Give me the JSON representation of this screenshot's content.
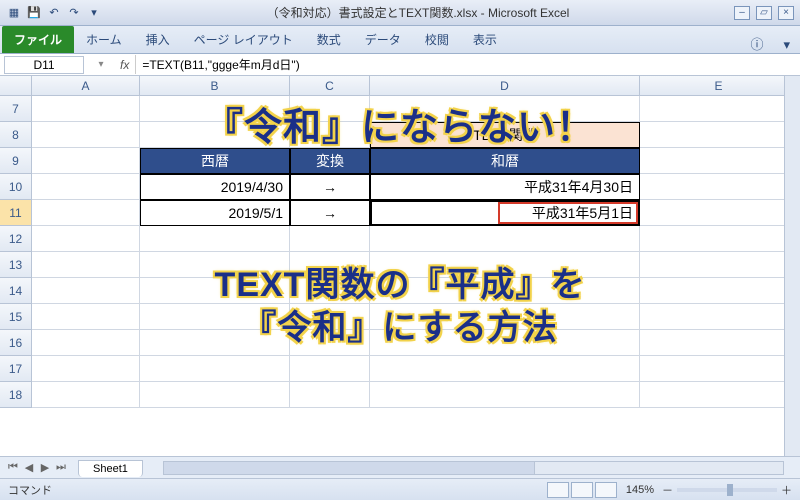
{
  "window": {
    "title": "（令和対応）書式設定とTEXT関数.xlsx - Microsoft Excel"
  },
  "ribbon": {
    "file": "ファイル",
    "tabs": [
      "ホーム",
      "挿入",
      "ページ レイアウト",
      "数式",
      "データ",
      "校閲",
      "表示"
    ]
  },
  "formula_bar": {
    "namebox": "D11",
    "fx": "fx",
    "formula": "=TEXT(B11,\"ggge年m月d日\")"
  },
  "columns": [
    "A",
    "B",
    "C",
    "D",
    "E"
  ],
  "visible_rows": [
    7,
    8,
    9,
    10,
    11,
    12,
    13,
    14,
    15,
    16,
    17,
    18
  ],
  "table": {
    "title": "TEXT関数",
    "headers": {
      "b": "西暦",
      "c": "変換",
      "d": "和暦"
    },
    "rows": [
      {
        "b": "2019/4/30",
        "c": "→",
        "d": "平成31年4月30日"
      },
      {
        "b": "2019/5/1",
        "c": "→",
        "d": "平成31年5月1日"
      }
    ]
  },
  "overlay": {
    "line1": "『令和』にならない！",
    "line2a": "TEXT関数の『平成』を",
    "line2b": "『令和』にする方法"
  },
  "sheet": {
    "name": "Sheet1"
  },
  "status": {
    "mode": "コマンド",
    "zoom": "145%",
    "minus": "－",
    "plus": "＋"
  }
}
